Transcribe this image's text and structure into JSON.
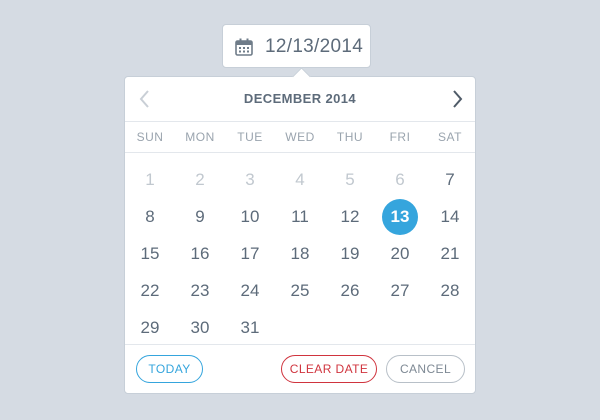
{
  "date_input": {
    "value": "12/13/2014",
    "icon": "calendar-icon"
  },
  "calendar": {
    "month_title": "DECEMBER 2014",
    "prev_icon": "chevron-left-icon",
    "next_icon": "chevron-right-icon",
    "weekdays": [
      "SUN",
      "MON",
      "TUE",
      "WED",
      "THU",
      "FRI",
      "SAT"
    ],
    "selected_day": "13",
    "weeks": [
      [
        {
          "label": "1",
          "muted": true
        },
        {
          "label": "2",
          "muted": true
        },
        {
          "label": "3",
          "muted": true
        },
        {
          "label": "4",
          "muted": true
        },
        {
          "label": "5",
          "muted": true
        },
        {
          "label": "6",
          "muted": true
        },
        {
          "label": "7",
          "muted": false
        }
      ],
      [
        {
          "label": "8",
          "muted": false
        },
        {
          "label": "9",
          "muted": false
        },
        {
          "label": "10",
          "muted": false
        },
        {
          "label": "11",
          "muted": false
        },
        {
          "label": "12",
          "muted": false
        },
        {
          "label": "13",
          "muted": false
        },
        {
          "label": "14",
          "muted": false
        }
      ],
      [
        {
          "label": "15",
          "muted": false
        },
        {
          "label": "16",
          "muted": false
        },
        {
          "label": "17",
          "muted": false
        },
        {
          "label": "18",
          "muted": false
        },
        {
          "label": "19",
          "muted": false
        },
        {
          "label": "20",
          "muted": false
        },
        {
          "label": "21",
          "muted": false
        }
      ],
      [
        {
          "label": "22",
          "muted": false
        },
        {
          "label": "23",
          "muted": false
        },
        {
          "label": "24",
          "muted": false
        },
        {
          "label": "25",
          "muted": false
        },
        {
          "label": "26",
          "muted": false
        },
        {
          "label": "27",
          "muted": false
        },
        {
          "label": "28",
          "muted": false
        }
      ],
      [
        {
          "label": "29",
          "muted": false
        },
        {
          "label": "30",
          "muted": false
        },
        {
          "label": "31",
          "muted": false
        }
      ]
    ]
  },
  "footer": {
    "today_label": "TODAY",
    "clear_label": "CLEAR DATE",
    "cancel_label": "CANCEL"
  },
  "colors": {
    "background": "#d5dbe3",
    "accent": "#35a5dd",
    "danger": "#d0343e",
    "text": "#5d6b7a",
    "muted": "#c1c8cf"
  }
}
